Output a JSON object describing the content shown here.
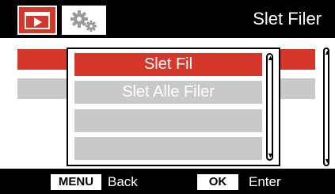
{
  "header": {
    "title": "Slet Filer",
    "tabs": [
      {
        "icon": "play-icon",
        "active": true
      },
      {
        "icon": "gears-icon",
        "active": false
      }
    ]
  },
  "popup": {
    "options": [
      {
        "label": "Slet Fil",
        "selected": true
      },
      {
        "label": "Slet Alle Filer",
        "selected": false
      },
      {
        "label": "",
        "selected": false
      },
      {
        "label": "",
        "selected": false
      }
    ]
  },
  "footer": {
    "menu_key": "MENU",
    "menu_label": "Back",
    "ok_key": "OK",
    "ok_label": "Enter"
  },
  "colors": {
    "accent": "#d6372b",
    "inactive_row": "#c9c9c9",
    "bar": "#000000"
  }
}
